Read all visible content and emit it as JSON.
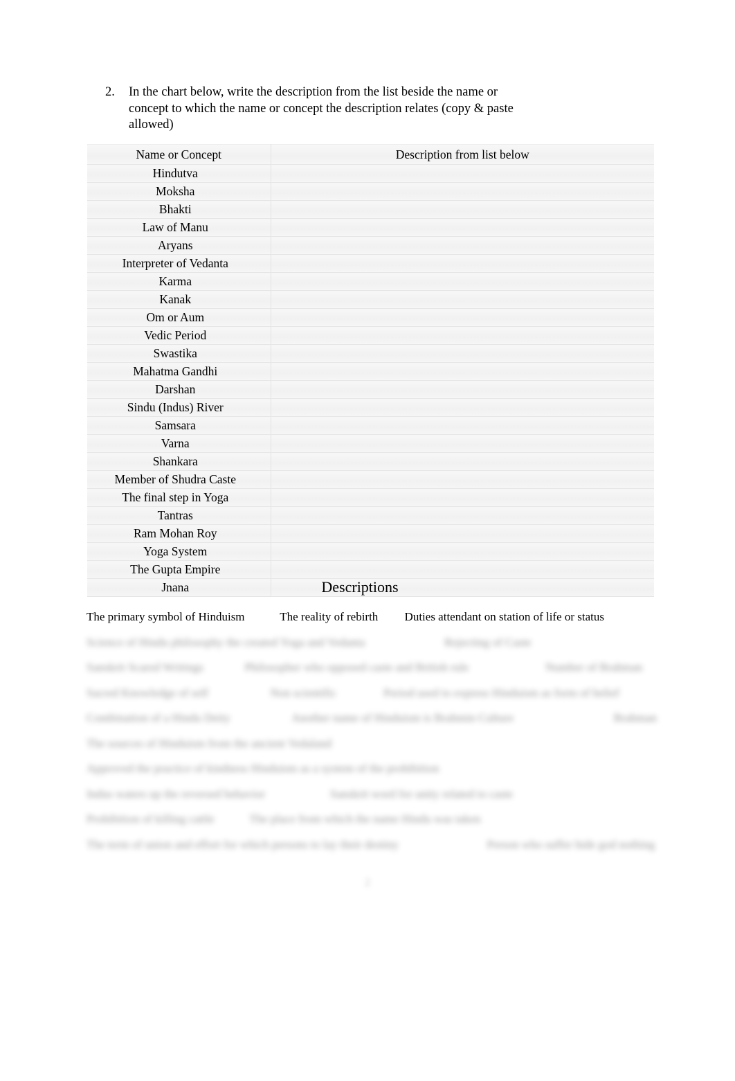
{
  "question": {
    "number": "2.",
    "text": "In the chart below, write the description from the list beside the name or concept to which the name or concept the description relates (copy & paste allowed)"
  },
  "table": {
    "headers": [
      "Name or Concept",
      "Description from list below"
    ],
    "rows": [
      {
        "name": "Hindutva",
        "description": ""
      },
      {
        "name": "Moksha",
        "description": ""
      },
      {
        "name": "Bhakti",
        "description": ""
      },
      {
        "name": "Law of Manu",
        "description": ""
      },
      {
        "name": "Aryans",
        "description": ""
      },
      {
        "name": "Interpreter of Vedanta",
        "description": ""
      },
      {
        "name": "Karma",
        "description": ""
      },
      {
        "name": "Kanak",
        "description": ""
      },
      {
        "name": "Om  or Aum",
        "description": ""
      },
      {
        "name": "Vedic Period",
        "description": ""
      },
      {
        "name": "Swastika",
        "description": ""
      },
      {
        "name": "Mahatma Gandhi",
        "description": ""
      },
      {
        "name": "Darshan",
        "description": ""
      },
      {
        "name": "Sindu (Indus) River",
        "description": ""
      },
      {
        "name": "Samsara",
        "description": ""
      },
      {
        "name": "Varna",
        "description": ""
      },
      {
        "name": "Shankara",
        "description": ""
      },
      {
        "name": "Member of Shudra Caste",
        "description": ""
      },
      {
        "name": "The final step in Yoga",
        "description": ""
      },
      {
        "name": "Tantras",
        "description": ""
      },
      {
        "name": "Ram Mohan Roy",
        "description": ""
      },
      {
        "name": "Yoga System",
        "description": ""
      },
      {
        "name": "The Gupta Empire",
        "description": ""
      },
      {
        "name": "Jnana",
        "description": ""
      }
    ]
  },
  "descriptions": {
    "heading": "Descriptions",
    "lines": [
      {
        "blurred": false,
        "text": "The primary symbol of Hinduism            The reality of rebirth         Duties attendant on station of life or status"
      },
      {
        "blurred": true,
        "text": "Science of Hindu philosophy the created Yoga and Vedanta                           Rejecting of Caste"
      },
      {
        "blurred": true,
        "text": "Sanskrit Scared Writings              Philosopher who opposed caste and British rule                          Number of Brahman"
      },
      {
        "blurred": true,
        "text": "Sacred Knowledge of self                     Non scientific                Period used to express Hinduism as form of belief"
      },
      {
        "blurred": true,
        "text": "Combination of a Hindu Deity                     Another name of Hinduism is Brahmin Culture                                  Brahman"
      },
      {
        "blurred": true,
        "text": "The sources of Hinduism from the ancient Vedaland"
      },
      {
        "blurred": true,
        "text": "Approved the practice of kindness Hinduism as a system of the prohibition"
      },
      {
        "blurred": true,
        "text": "Indus waters up the reversed behavior                      Sanskrit word for unity related to caste"
      },
      {
        "blurred": true,
        "text": "Prohibition of killing cattle            The place from which the name Hindu was taken"
      },
      {
        "blurred": true,
        "text": "The term of union and effort for which persons to lay their destiny                              Person who suffer hide god nothing"
      }
    ]
  },
  "page_number": "2"
}
